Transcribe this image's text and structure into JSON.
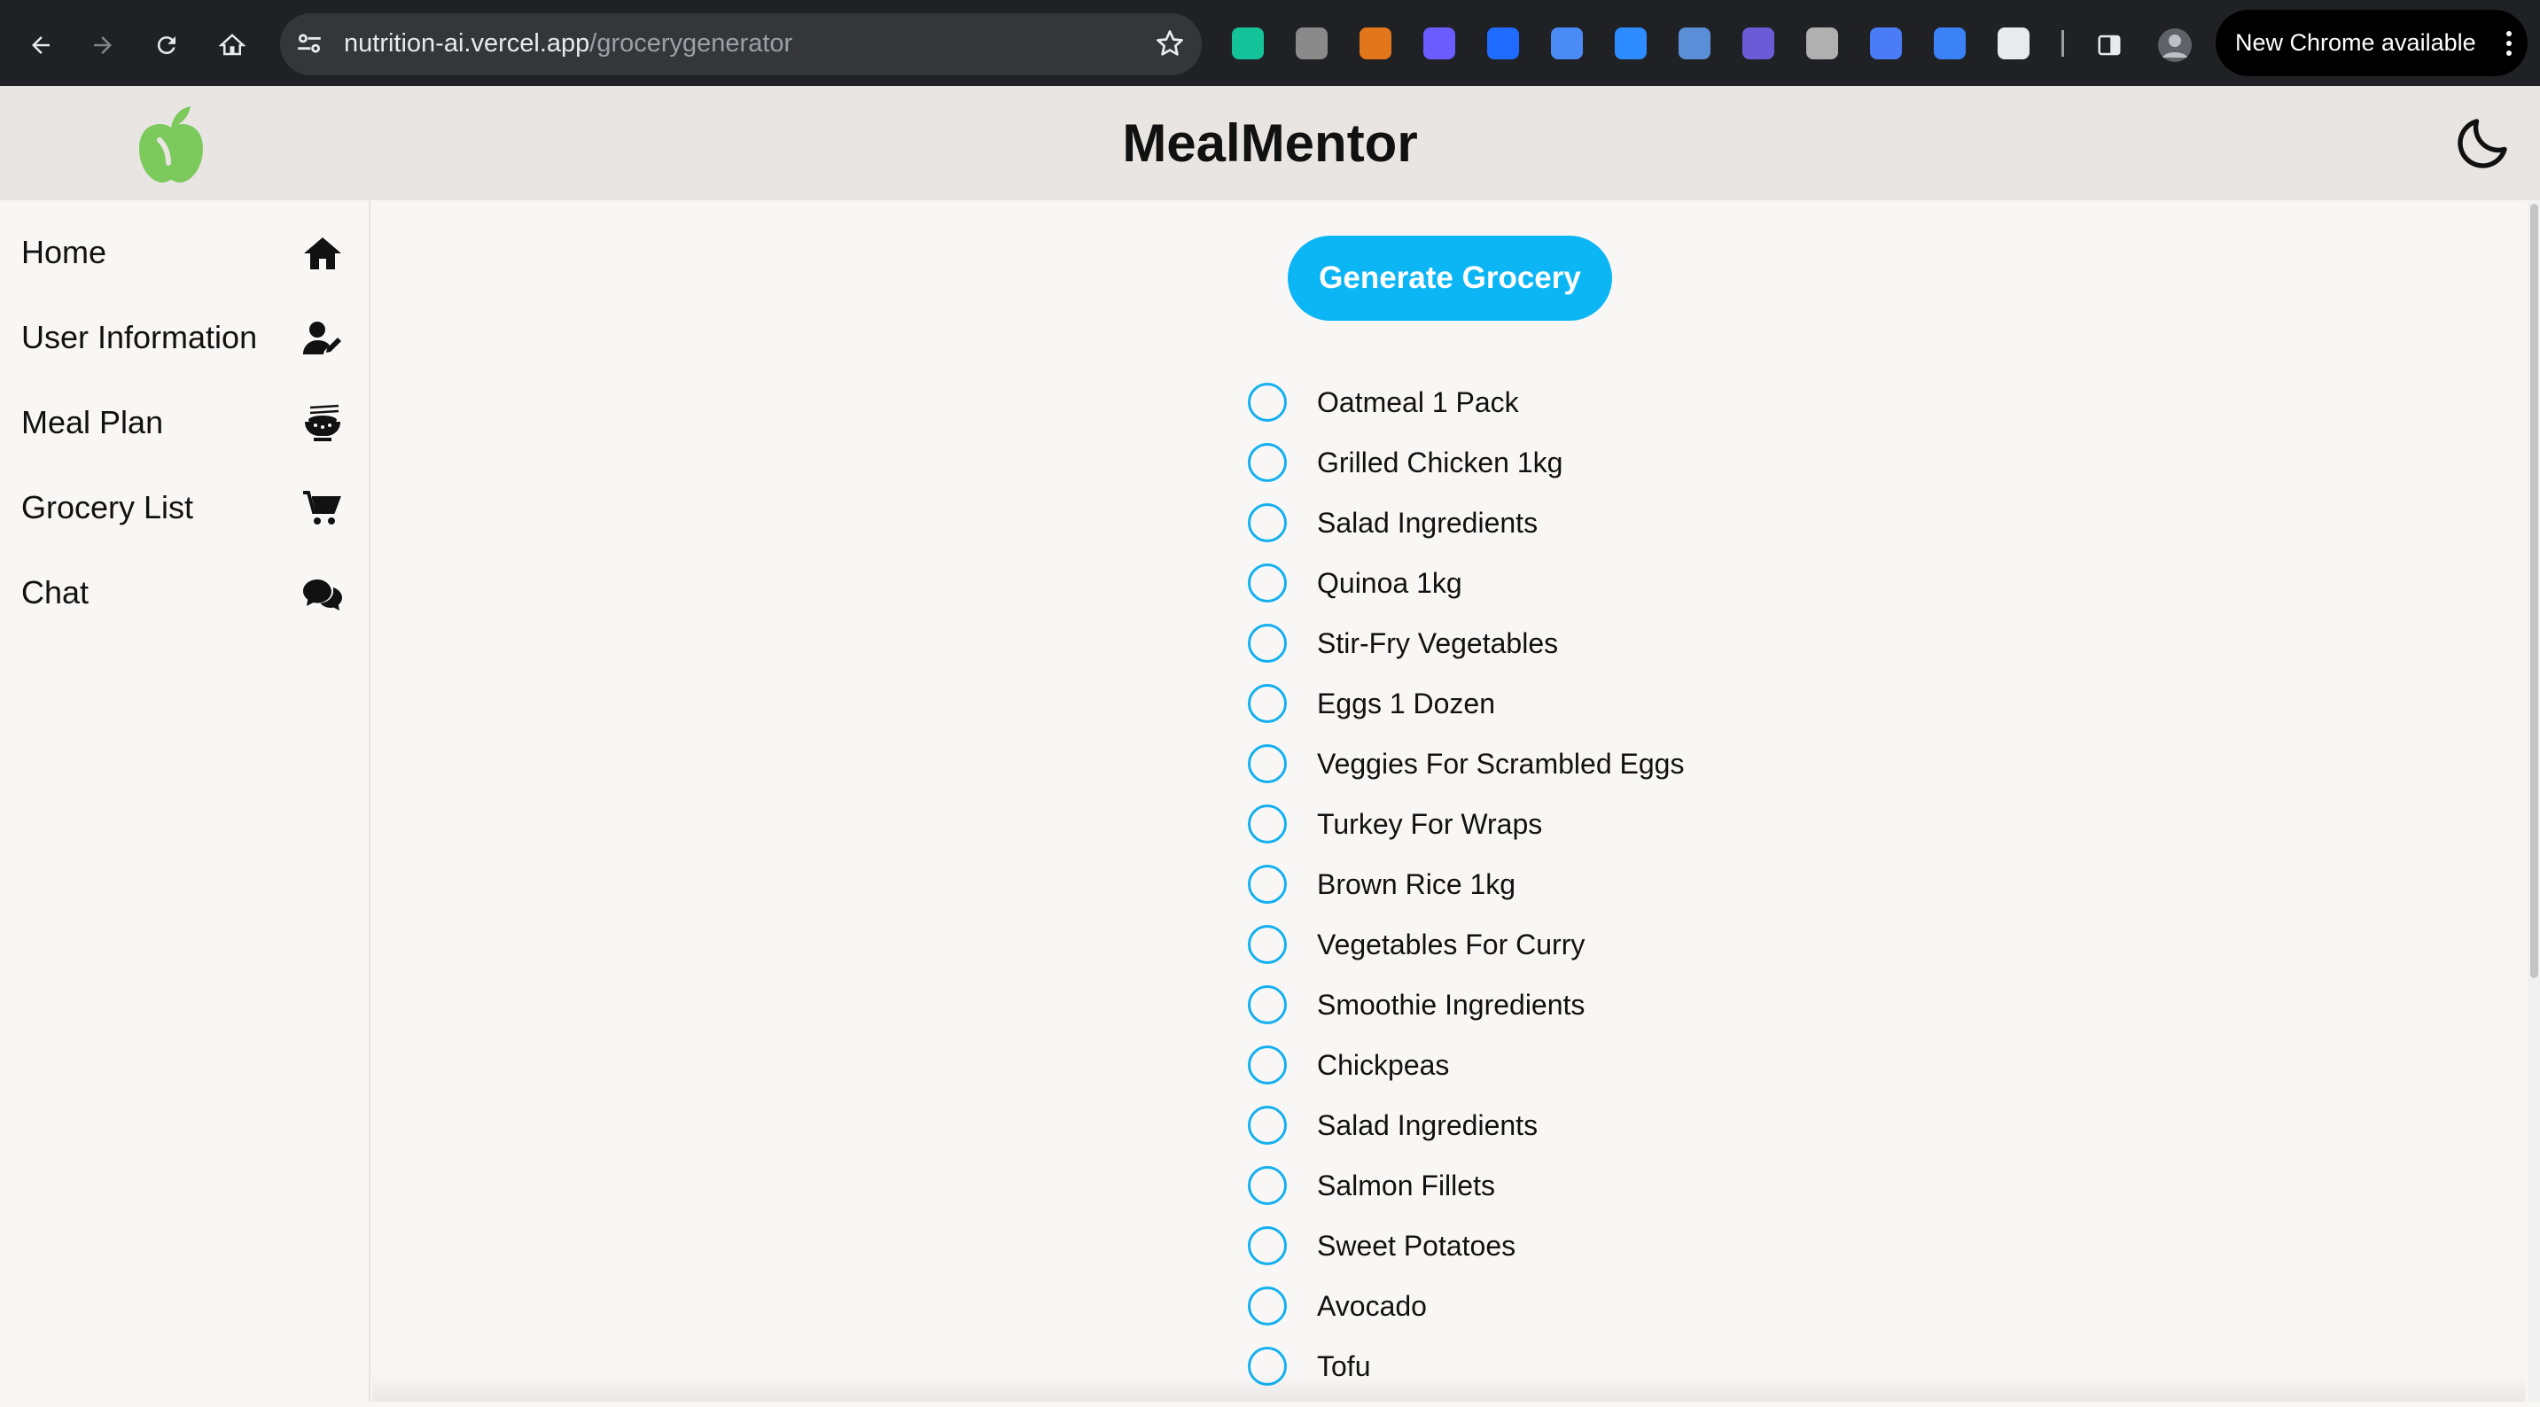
{
  "browser": {
    "url_host": "nutrition-ai.vercel.app",
    "url_path": "/grocerygenerator",
    "update_label": "New Chrome available",
    "extensions": [
      {
        "icon": "grammarly-icon",
        "color": "#15c39a"
      },
      {
        "icon": "extension-puzzle-gray-icon",
        "color": "#8a8a8a"
      },
      {
        "icon": "metamask-fox-icon",
        "color": "#e2761b"
      },
      {
        "icon": "purple-spark-icon",
        "color": "#6a5cff"
      },
      {
        "icon": "blue-tiles-icon",
        "color": "#1f6bff"
      },
      {
        "icon": "google-translate-icon",
        "color": "#4b8bf5"
      },
      {
        "icon": "zoom-icon",
        "color": "#2d8cff"
      },
      {
        "icon": "circle-badge-icon",
        "color": "#5a8fd8"
      },
      {
        "icon": "purple-check-icon",
        "color": "#6b5bd6"
      },
      {
        "icon": "gray-c-icon",
        "color": "#b0b0b0"
      },
      {
        "icon": "screen-record-icon",
        "color": "#4a7cf7"
      },
      {
        "icon": "blue-c-icon",
        "color": "#3b82f6"
      },
      {
        "icon": "extensions-puzzle-icon",
        "color": "#e8eaed"
      }
    ]
  },
  "header": {
    "title": "MealMentor",
    "logo_color": "#7cc95c"
  },
  "sidebar": {
    "items": [
      {
        "label": "Home",
        "icon": "home-icon"
      },
      {
        "label": "User Information",
        "icon": "user-edit-icon"
      },
      {
        "label": "Meal Plan",
        "icon": "bowl-chopsticks-icon"
      },
      {
        "label": "Grocery List",
        "icon": "shopping-cart-icon"
      },
      {
        "label": "Chat",
        "icon": "chat-bubbles-icon"
      }
    ]
  },
  "main": {
    "generate_label": "Generate Grocery",
    "accent": "#0cb6f5",
    "items": [
      "Oatmeal 1 Pack",
      "Grilled Chicken 1kg",
      "Salad Ingredients",
      "Quinoa 1kg",
      "Stir-Fry Vegetables",
      "Eggs 1 Dozen",
      "Veggies For Scrambled Eggs",
      "Turkey For Wraps",
      "Brown Rice 1kg",
      "Vegetables For Curry",
      "Smoothie Ingredients",
      "Chickpeas",
      "Salad Ingredients",
      "Salmon Fillets",
      "Sweet Potatoes",
      "Avocado",
      "Tofu"
    ]
  }
}
